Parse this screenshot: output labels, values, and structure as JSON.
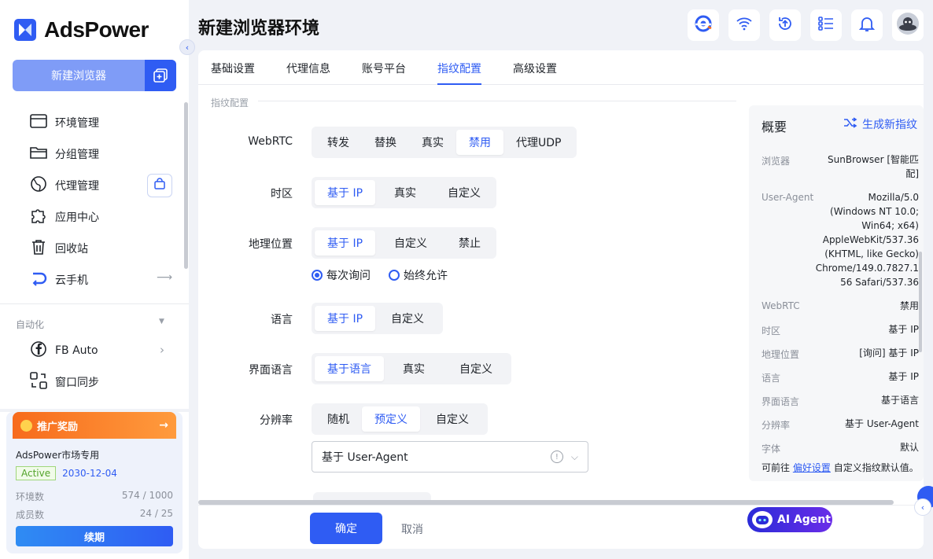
{
  "app": {
    "brand": "AdsPower",
    "page_title": "新建浏览器环境"
  },
  "sidebar": {
    "new_browser_label": "新建浏览器",
    "items": [
      {
        "label": "环境管理",
        "icon": "browser-window-icon"
      },
      {
        "label": "分组管理",
        "icon": "folder-icon"
      },
      {
        "label": "代理管理",
        "icon": "globe-icon"
      },
      {
        "label": "应用中心",
        "icon": "puzzle-icon"
      },
      {
        "label": "回收站",
        "icon": "trash-icon"
      },
      {
        "label": "云手机",
        "icon": "cloud-phone-icon"
      }
    ],
    "automation_label": "自动化",
    "automation_items": [
      {
        "label": "FB Auto",
        "icon": "facebook-icon"
      },
      {
        "label": "窗口同步",
        "icon": "sync-windows-icon"
      }
    ],
    "promo": {
      "title": "推广奖励",
      "account": "AdsPower市场专用",
      "status": "Active",
      "expiry": "2030-12-04",
      "env_label": "环境数",
      "env_value": "574 / 1000",
      "member_label": "成员数",
      "member_value": "24 / 25",
      "renew_label": "续期"
    }
  },
  "tabs": [
    "基础设置",
    "代理信息",
    "账号平台",
    "指纹配置",
    "高级设置"
  ],
  "active_tab": "指纹配置",
  "form": {
    "section_label": "指纹配置",
    "webrtc": {
      "label": "WebRTC",
      "options": [
        "转发",
        "替换",
        "真实",
        "禁用",
        "代理UDP"
      ],
      "selected": "禁用"
    },
    "timezone": {
      "label": "时区",
      "options": [
        "基于 IP",
        "真实",
        "自定义"
      ],
      "selected": "基于 IP"
    },
    "geo": {
      "label": "地理位置",
      "options": [
        "基于 IP",
        "自定义",
        "禁止"
      ],
      "selected": "基于 IP",
      "radio_ask": "每次询问",
      "radio_allow": "始终允许",
      "radio_selected": "每次询问"
    },
    "language": {
      "label": "语言",
      "options": [
        "基于 IP",
        "自定义"
      ],
      "selected": "基于 IP"
    },
    "ui_language": {
      "label": "界面语言",
      "options": [
        "基于语言",
        "真实",
        "自定义"
      ],
      "selected": "基于语言"
    },
    "resolution": {
      "label": "分辨率",
      "options": [
        "随机",
        "预定义",
        "自定义"
      ],
      "selected": "预定义",
      "select_value": "基于 User-Agent"
    }
  },
  "summary": {
    "title": "概要",
    "generate_label": "生成新指纹",
    "rows": [
      {
        "key": "浏览器",
        "value": [
          "SunBrowser [智能匹",
          "配]"
        ]
      },
      {
        "key": "User-Agent",
        "value": [
          "Mozilla/5.0",
          "(Windows NT 10.0;",
          "Win64; x64)",
          "AppleWebKit/537.36",
          "(KHTML, like Gecko)",
          "Chrome/149.0.7827.1",
          "56 Safari/537.36"
        ]
      },
      {
        "key": "WebRTC",
        "value": [
          "禁用"
        ]
      },
      {
        "key": "时区",
        "value": [
          "基于 IP"
        ]
      },
      {
        "key": "地理位置",
        "value": [
          "[询问] 基于 IP"
        ]
      },
      {
        "key": "语言",
        "value": [
          "基于 IP"
        ]
      },
      {
        "key": "界面语言",
        "value": [
          "基于语言"
        ]
      },
      {
        "key": "分辨率",
        "value": [
          "基于 User-Agent"
        ]
      },
      {
        "key": "字体",
        "value": [
          "默认"
        ]
      }
    ],
    "footer_prefix": "可前往",
    "footer_link": "偏好设置",
    "footer_suffix": "自定义指纹默认值。"
  },
  "footer": {
    "ok_label": "确定",
    "cancel_label": "取消"
  },
  "ai_agent_label": "AI Agent",
  "colors": {
    "accent": "#2f5cf3",
    "promo": "#f76b1c"
  }
}
